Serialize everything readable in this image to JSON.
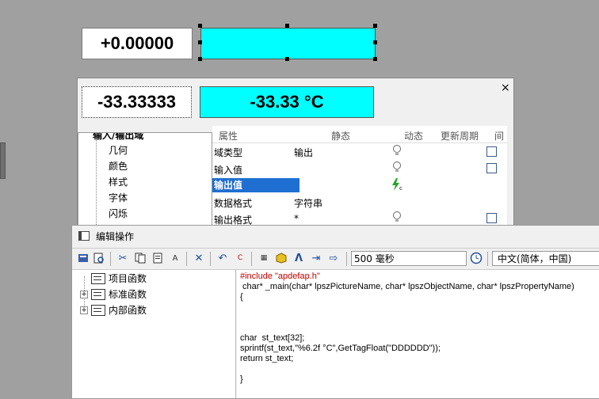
{
  "canvas": {
    "io_field_1_value": "+0.00000",
    "io_field_2_value": "-33.33333",
    "output_field_text": "-33.33 °C"
  },
  "properties_dialog": {
    "close_label": "×",
    "tree_items": [
      "输入/输出域",
      "几何",
      "颜色",
      "样式",
      "字体",
      "闪烁"
    ],
    "columns": [
      "属性",
      "静态",
      "动态",
      "更新周期",
      "间"
    ],
    "rows": [
      {
        "name": "域类型",
        "static": "输出",
        "dynamic": "bulb",
        "checkbox": true
      },
      {
        "name": "输入值",
        "static": "",
        "dynamic": "bulb",
        "checkbox": true
      },
      {
        "name": "输出值",
        "static": "",
        "dynamic": "c-action",
        "checkbox": false,
        "selected": true
      },
      {
        "name": "数据格式",
        "static": "字符串",
        "dynamic": "",
        "checkbox": false
      },
      {
        "name": "输出格式",
        "static": "*",
        "dynamic": "bulb",
        "checkbox": true
      }
    ]
  },
  "editor": {
    "title": "编辑操作",
    "update_cycle": "500 毫秒",
    "language": "中文(简体，中国)",
    "function_tree": [
      "项目函数",
      "标准函数",
      "内部函数"
    ],
    "code_lines": [
      "#include \"apdefap.h\"",
      " char* _main(char* lpszPictureName, char* lpszObjectName, char* lpszPropertyName)",
      "{",
      "",
      "",
      "",
      "char  st_text[32];",
      "sprintf(st_text,\"%6.2f °C\",GetTagFloat(\"DDDDDD\"));",
      "return st_text;",
      "",
      "}"
    ]
  },
  "colors": {
    "output_field_bg": "#00ffff",
    "selection": "#1f6fd2",
    "canvas_bg": "#a0a0a0"
  }
}
